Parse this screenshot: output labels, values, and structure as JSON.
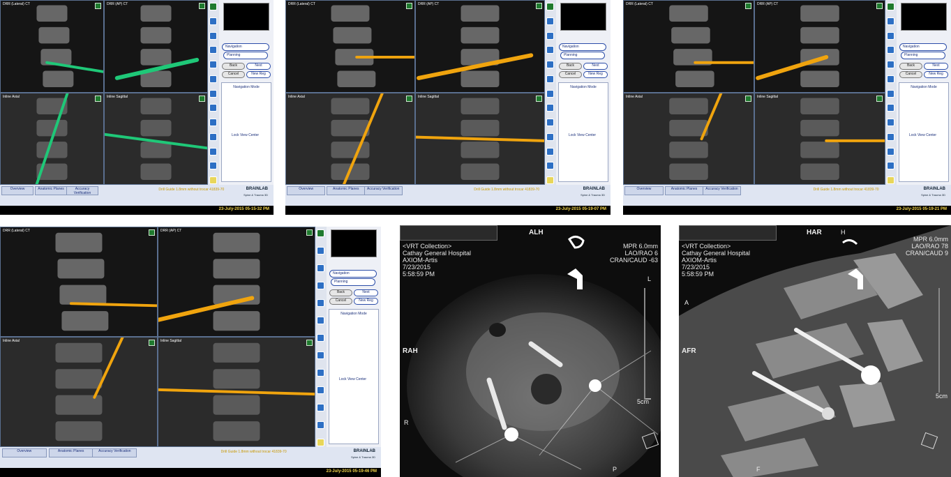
{
  "screens": [
    {
      "viewports": [
        "DRR (Lateral) CT",
        "DRR (AP) CT",
        "Inline Axial",
        "Inline Sagittal"
      ],
      "nav": {
        "navigation": "Navigation",
        "planning": "Planning",
        "back": "Back",
        "next": "Next",
        "cancel": "Cancel",
        "new_reg": "New Reg",
        "mode": "Navigation Mode",
        "lock": "Lock View Center"
      },
      "tabs": [
        "Overview",
        "Anatomic Planes",
        "Accuracy Verification"
      ],
      "drill": "Drill Guide 1.8mm without trocar 41839-70",
      "brand": "BRAINLAB",
      "brand_sub": "Spine & Trauma 3D",
      "timestamp": "23-July-2015  05-15-32 PM",
      "tool_color": "#1fc878"
    },
    {
      "viewports": [
        "DRR (Lateral) CT",
        "DRR (AP) CT",
        "Inline Axial",
        "Inline Sagittal"
      ],
      "nav": {
        "navigation": "Navigation",
        "planning": "Planning",
        "back": "Back",
        "next": "Next",
        "cancel": "Cancel",
        "new_reg": "New Reg",
        "mode": "Navigation Mode",
        "lock": "Lock View Center"
      },
      "tabs": [
        "Overview",
        "Anatomic Planes",
        "Accuracy Verification"
      ],
      "drill": "Drill Guide 1.8mm without trocar 41839-70",
      "brand": "BRAINLAB",
      "brand_sub": "Spine & Trauma 3D",
      "timestamp": "23-July-2015  05-19-07 PM",
      "tool_color": "#f0a40e"
    },
    {
      "viewports": [
        "DRR (Lateral) CT",
        "DRR (AP) CT",
        "Inline Axial",
        "Inline Sagittal"
      ],
      "nav": {
        "navigation": "Navigation",
        "planning": "Planning",
        "back": "Back",
        "next": "Next",
        "cancel": "Cancel",
        "new_reg": "New Reg",
        "mode": "Navigation Mode",
        "lock": "Lock View Center"
      },
      "tabs": [
        "Overview",
        "Anatomic Planes",
        "Accuracy Verification"
      ],
      "drill": "Drill Guide 1.8mm without trocar 41839-70",
      "brand": "BRAINLAB",
      "brand_sub": "Spine & Trauma 3D",
      "timestamp": "23-July-2015  05-19-21 PM",
      "tool_color": "#f0a40e"
    },
    {
      "viewports": [
        "DRR (Lateral) CT",
        "DRR (AP) CT",
        "Inline Axial",
        "Inline Sagittal"
      ],
      "nav": {
        "navigation": "Navigation",
        "planning": "Planning",
        "back": "Back",
        "next": "Next",
        "cancel": "Cancel",
        "new_reg": "New Reg",
        "mode": "Navigation Mode",
        "lock": "Lock View Center"
      },
      "tabs": [
        "Overview",
        "Anatomic Planes",
        "Accuracy Verification"
      ],
      "drill": "Drill Guide 1.8mm without trocar 41839-70",
      "brand": "BRAINLAB",
      "brand_sub": "Spine & Trauma 3D",
      "timestamp": "23-July-2015  05-19-46 PM",
      "tool_color": "#f0a40e"
    }
  ],
  "ct_views": [
    {
      "header": "ALH",
      "left": "RAH",
      "bottom": "P",
      "side_r": "R",
      "side_l": "L",
      "info": [
        "<VRT Collection>",
        "Cathay General Hospital",
        "AXIOM-Artis",
        "7/23/2015",
        "5:58:59 PM"
      ],
      "params": [
        "MPR  6.0mm",
        "LAO/RAO    6",
        "CRAN/CAUD  -63"
      ],
      "scale": "5cm"
    },
    {
      "header": "HAR",
      "left": "AFR",
      "top_right": "H",
      "side_a": "A",
      "bottom": "F",
      "info": [
        "<VRT Collection>",
        "Cathay General Hospital",
        "AXIOM-Artis",
        "7/23/2015",
        "5:58:59 PM"
      ],
      "params": [
        "MPR  6.0mm",
        "LAO/RAO   78",
        "CRAN/CAUD   9"
      ],
      "scale": "5cm"
    }
  ]
}
